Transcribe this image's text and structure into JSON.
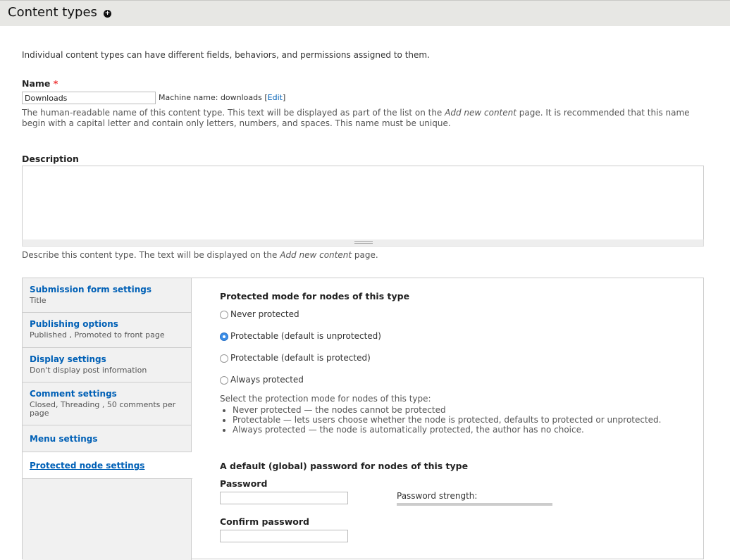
{
  "header": {
    "title": "Content types",
    "add_icon": "plus-circle-icon"
  },
  "intro": "Individual content types can have different fields, behaviors, and permissions assigned to them.",
  "name_field": {
    "label": "Name",
    "required_marker": "*",
    "value": "Downloads",
    "machine_name_prefix": "Machine name: downloads",
    "edit_link": "Edit",
    "help": "The human-readable name of this content type. This text will be displayed as part of the list on the Add new content page. It is recommended that this name begin with a capital letter and contain only letters, numbers, and spaces. This name must be unique."
  },
  "description_field": {
    "label": "Description",
    "value": "",
    "help": "Describe this content type. The text will be displayed on the Add new content page."
  },
  "vertical_tabs": [
    {
      "title": "Submission form settings",
      "summary": "Title"
    },
    {
      "title": "Publishing options",
      "summary": "Published , Promoted to front page"
    },
    {
      "title": "Display settings",
      "summary": "Don't display post information"
    },
    {
      "title": "Comment settings",
      "summary": "Closed, Threading , 50 comments per page"
    },
    {
      "title": "Menu settings",
      "summary": ""
    },
    {
      "title": "Protected node settings",
      "summary": "",
      "selected": true
    }
  ],
  "protected_pane": {
    "mode_heading": "Protected mode for nodes of this type",
    "options": [
      {
        "label": "Never protected",
        "checked": false
      },
      {
        "label": "Protectable (default is unprotected)",
        "checked": true
      },
      {
        "label": "Protectable (default is protected)",
        "checked": false
      },
      {
        "label": "Always protected",
        "checked": false
      }
    ],
    "mode_help": "Select the protection mode for nodes of this type:",
    "mode_help_items": [
      "Never protected — the nodes cannot be protected",
      "Protectable — lets users choose whether the node is protected, defaults to protected or unprotected.",
      "Always protected — the node is automatically protected, the author has no choice."
    ],
    "password_heading": "A default (global) password for nodes of this type",
    "password_label": "Password",
    "password_value": "",
    "strength_label": "Password strength:",
    "confirm_label": "Confirm password",
    "confirm_value": ""
  },
  "colors": {
    "link": "#0060b6",
    "header_bg": "#e7e7e4",
    "radio_checked": "#3b8ee8"
  }
}
